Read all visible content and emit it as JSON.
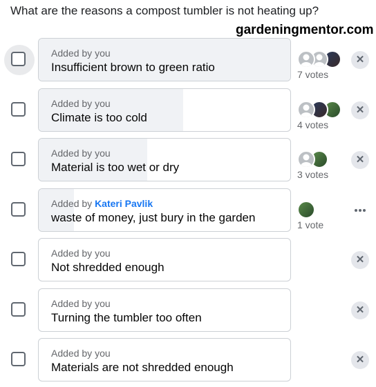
{
  "question": "What are the reasons a compost tumbler is not heating up?",
  "watermark": "gardeningmentor.com",
  "options": [
    {
      "added_prefix": "Added by",
      "author": "you",
      "author_highlight": false,
      "label": "Insufficient brown to green ratio",
      "votes": "7 votes",
      "vote_share": 1.0,
      "voter_avatars": [
        "avatar-gray-icon",
        "avatar-gray-icon",
        "avatar-photo-icon"
      ],
      "action": "remove-icon"
    },
    {
      "added_prefix": "Added by",
      "author": "you",
      "author_highlight": false,
      "label": "Climate is too cold",
      "votes": "4 votes",
      "vote_share": 0.57,
      "voter_avatars": [
        "avatar-gray-icon",
        "avatar-photo-icon",
        "avatar-photo-icon"
      ],
      "action": "remove-icon"
    },
    {
      "added_prefix": "Added by",
      "author": "you",
      "author_highlight": false,
      "label": "Material is too wet or dry",
      "votes": "3 votes",
      "vote_share": 0.43,
      "voter_avatars": [
        "avatar-gray-icon",
        "avatar-photo-icon"
      ],
      "action": "remove-icon"
    },
    {
      "added_prefix": "Added by",
      "author": "Kateri Pavlik",
      "author_highlight": true,
      "label": "waste of money, just bury in the garden",
      "votes": "1 vote",
      "vote_share": 0.14,
      "voter_avatars": [
        "avatar-photo-icon"
      ],
      "action": "more-options-icon"
    },
    {
      "added_prefix": "Added by",
      "author": "you",
      "author_highlight": false,
      "label": "Not shredded enough",
      "votes": "",
      "vote_share": 0,
      "voter_avatars": [],
      "action": "remove-icon"
    },
    {
      "added_prefix": "Added by",
      "author": "you",
      "author_highlight": false,
      "label": "Turning the tumbler too often",
      "votes": "",
      "vote_share": 0,
      "voter_avatars": [],
      "action": "remove-icon"
    },
    {
      "added_prefix": "Added by",
      "author": "you",
      "author_highlight": false,
      "label": "Materials are not shredded enough",
      "votes": "",
      "vote_share": 0,
      "voter_avatars": [],
      "action": "remove-icon"
    }
  ],
  "colors": {
    "vote_bar": "#f0f2f5",
    "author_link": "#1877f2",
    "border": "#ccd0d5",
    "muted_text": "#65676b",
    "remove_button_bg": "#e4e6eb"
  }
}
